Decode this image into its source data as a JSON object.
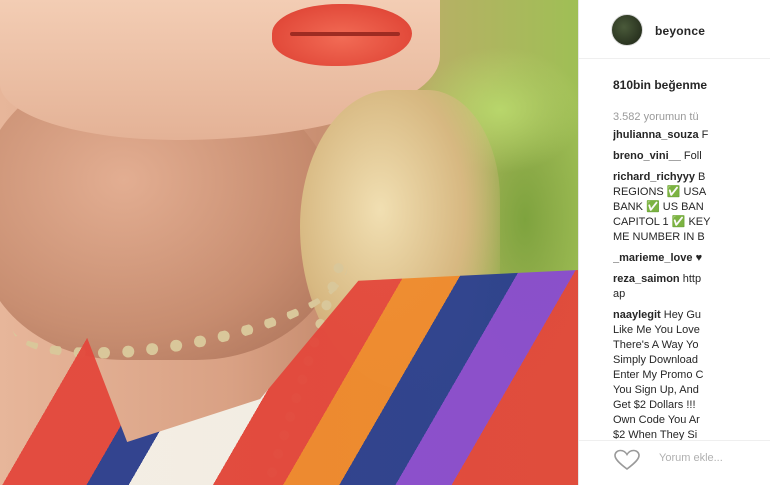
{
  "post": {
    "username": "beyonce",
    "likes": "810bin beğenme",
    "more_comments": "3.582 yorumun tü",
    "add_comment_placeholder": "Yorum ekle...",
    "comments": [
      {
        "user": "jhulianna_souza",
        "lines": [
          "F"
        ]
      },
      {
        "user": "breno_vini__",
        "lines": [
          "Foll"
        ]
      },
      {
        "user": "richard_richyyy",
        "lines": [
          "B",
          "REGIONS ✅ USA",
          "BANK ✅ US BAN",
          "CAPITOL 1 ✅ KEY",
          "ME NUMBER IN B"
        ]
      },
      {
        "user": "_marieme_love",
        "lines": [
          "♥"
        ]
      },
      {
        "user": "reza_saimon",
        "lines": [
          "http",
          "ap"
        ]
      },
      {
        "user": "naaylegit",
        "lines": [
          "Hey Gu",
          "Like Me You Love",
          "There's A Way Yo",
          "Simply Download",
          "Enter My Promo C",
          "You Sign Up, And",
          "Get $2 Dollars !!! ",
          "Own Code You Ar",
          "$2 When They Si"
        ]
      }
    ]
  },
  "icons": {
    "like": "heart-outline-icon",
    "avatar": "profile-avatar"
  }
}
